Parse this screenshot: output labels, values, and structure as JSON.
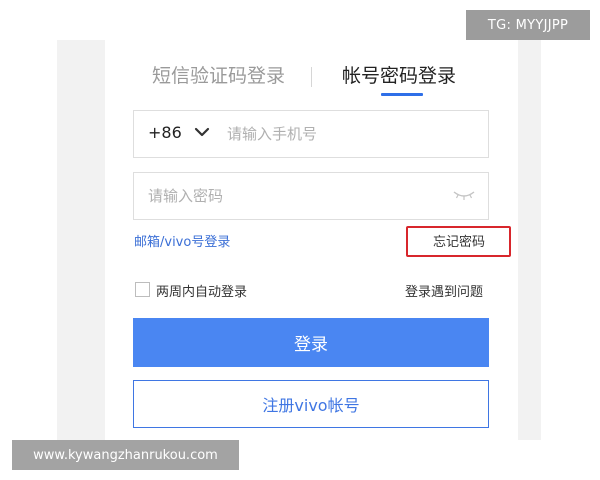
{
  "tabs": [
    {
      "label": "短信验证码登录",
      "active": false
    },
    {
      "label": "帐号密码登录",
      "active": true
    }
  ],
  "phone": {
    "country_code": "+86",
    "placeholder": "请输入手机号"
  },
  "password": {
    "placeholder": "请输入密码"
  },
  "links": {
    "email_login": "邮箱/vivo号登录",
    "forgot_password": "忘记密码"
  },
  "remember": {
    "label": "两周内自动登录",
    "checked": false
  },
  "trouble": "登录遇到问题",
  "buttons": {
    "login": "登录",
    "register": "注册vivo帐号"
  },
  "watermarks": {
    "top": "TG: MYYJJPP",
    "bottom": "www.kywangzhanrukou.com"
  },
  "colors": {
    "accent": "#4a86f2",
    "link": "#3b6fd6",
    "highlight": "#d8262c"
  }
}
